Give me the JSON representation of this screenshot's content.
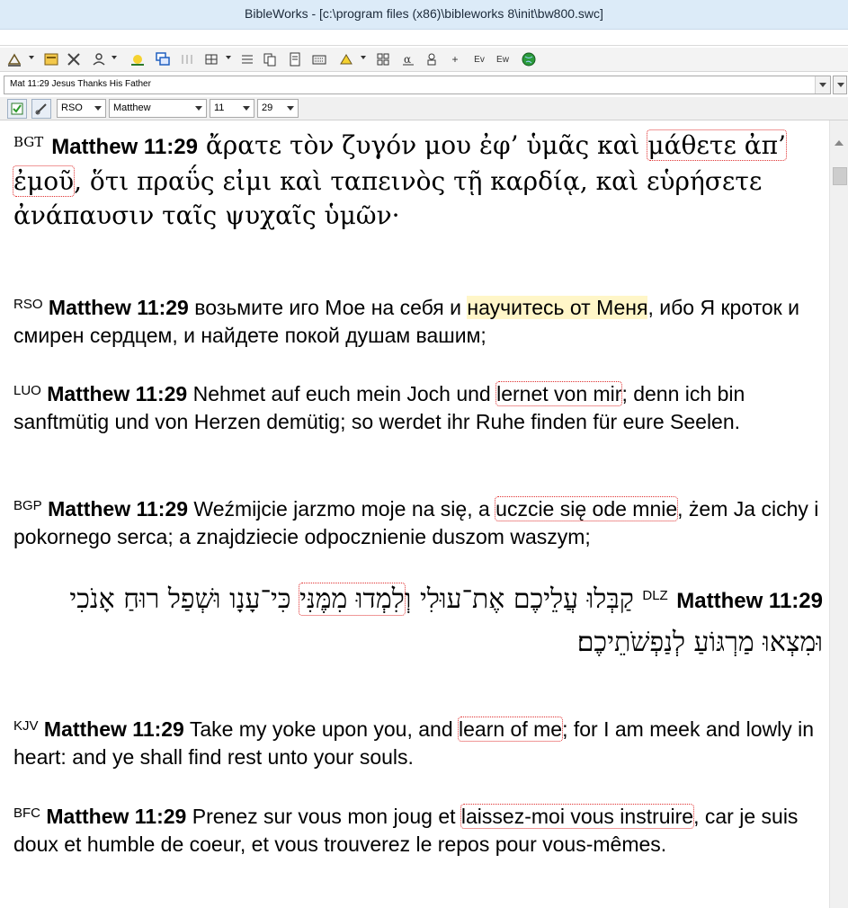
{
  "window": {
    "title": "BibleWorks - [c:\\program files (x86)\\bibleworks 8\\init\\bw800.swc]"
  },
  "toolbar": {
    "icons": [
      "search-icon",
      "open-icon",
      "tools-icon",
      "plugin-icon",
      "lightbulb-icon",
      "window-icon",
      "parse-icon",
      "grid-icon",
      "list-icon",
      "copy-icon",
      "document-icon",
      "keyboard-icon",
      "analysis-icon",
      "compare-icon",
      "alpha-icon",
      "person-icon",
      "add-icon",
      "ev-icon",
      "ew-icon",
      "globe-icon"
    ],
    "labels": {
      "plus": "+",
      "ev": "Ev",
      "ew": "Ew"
    }
  },
  "verse_bar": {
    "value": "Mat 11:29 Jesus Thanks His Father"
  },
  "panel_bar": {
    "version": "RSO",
    "book": "Matthew",
    "chapter": "11",
    "verse": "29"
  },
  "verses": {
    "bgt": {
      "version": "BGT",
      "ref": "Matthew 11:29",
      "pre": " ἄρατε τὸν ζυγόν μου ἐφ’ ὑμᾶς καὶ ",
      "mark": "μάθετε ἀπ’ ἐμοῦ",
      "post": ", ὅτι πραΰς εἰμι καὶ ταπεινὸς τῇ καρδίᾳ, καὶ εὑρήσετε ἀνάπαυσιν ταῖς ψυχαῖς ὑμῶν·"
    },
    "rso": {
      "version": "RSO",
      "ref": "Matthew 11:29",
      "pre": " возьмите иго Мое на себя и ",
      "mark": "научитесь от Меня",
      "post": ", ибо Я кроток и смирен сердцем, и найдете покой душам вашим;"
    },
    "luo": {
      "version": "LUO",
      "ref": "Matthew 11:29",
      "pre": " Nehmet auf euch mein Joch und ",
      "mark": "lernet von mir",
      "post": "; denn ich bin sanftmütig und von Herzen demütig; so werdet ihr Ruhe finden für eure Seelen."
    },
    "bgp": {
      "version": "BGP",
      "ref": "Matthew 11:29",
      "pre": " Weźmijcie jarzmo moje na się, a ",
      "mark": "uczcie się ode mnie",
      "post": ", żem Ja cichy i pokornego serca; a znajdziecie odpocznienie duszom waszym;"
    },
    "dlz": {
      "version": "DLZ",
      "ref": "Matthew 11:29",
      "pre": " קַבְּלוּ עֲלֵיכֶם אֶת־עוּלִי וְ",
      "mark": "לִמְדוּ מִמֶּנִּי",
      "post": " כִּי־עָנָו וּשְׁפַל רוּחַ אָנֹכִי וּמִצְאוּ מַרְגּוֹעַ לְנַפְשֹׁתֵיכֶם׃"
    },
    "kjv": {
      "version": "KJV",
      "ref": "Matthew 11:29",
      "pre": " Take my yoke upon you, and ",
      "mark": "learn of me",
      "post": "; for I am meek and lowly in heart: and ye shall find rest unto your souls."
    },
    "bfc": {
      "version": "BFC",
      "ref": "Matthew 11:29",
      "pre": " Prenez sur vous mon joug et ",
      "mark": "laissez-moi vous instruire",
      "post": ", car je suis doux et humble de coeur, et vous trouverez le repos pour vous-mêmes."
    }
  },
  "colors": {
    "highlight": "#fff6c8",
    "mark": "#e03030",
    "titlebar": "#dcebf8"
  }
}
